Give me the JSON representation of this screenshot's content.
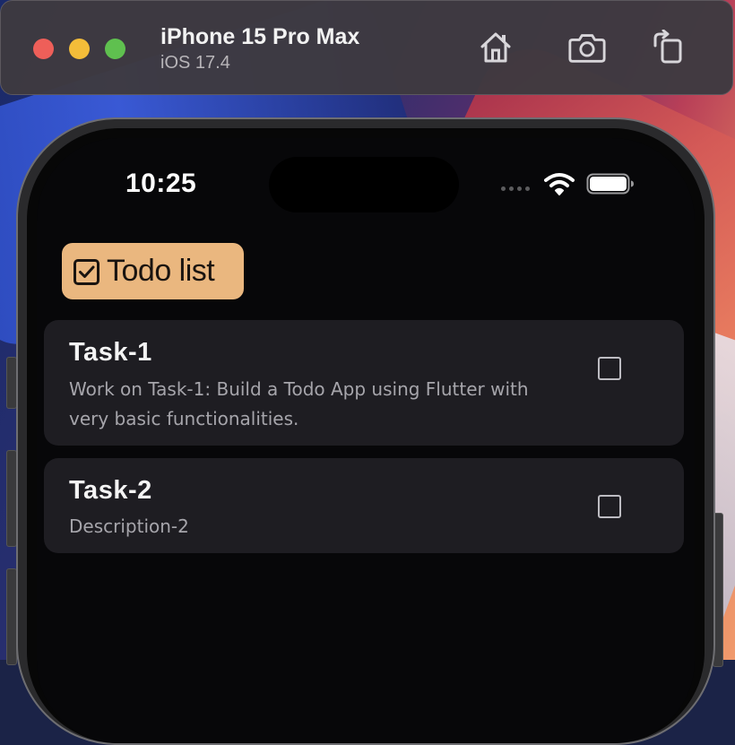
{
  "simulator": {
    "device_name": "iPhone 15 Pro Max",
    "os_version": "iOS 17.4",
    "toolbar_icons": [
      "home-icon",
      "screenshot-camera-icon",
      "rotate-icon"
    ]
  },
  "status_bar": {
    "time": "10:25",
    "icons": [
      "signal-dots-icon",
      "wifi-icon",
      "battery-icon"
    ]
  },
  "app": {
    "title": "Todo list",
    "title_icon": "checkbox-checked-icon",
    "accent_color": "#eab77f",
    "card_color": "#1e1d22"
  },
  "tasks": [
    {
      "title": "Task-1",
      "description": "Work on Task-1: Build a Todo App using Flutter with very basic functionalities.",
      "done": false
    },
    {
      "title": "Task-2",
      "description": "Description-2",
      "done": false
    }
  ]
}
